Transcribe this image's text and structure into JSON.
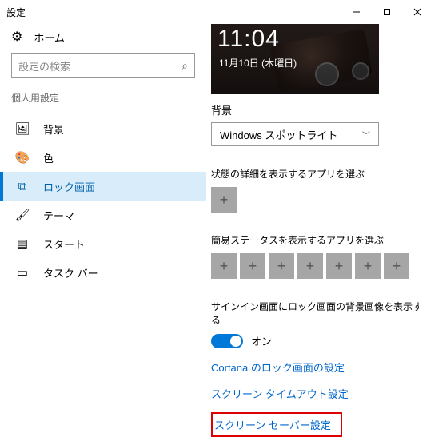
{
  "window": {
    "title": "設定"
  },
  "sidebar": {
    "home": "ホーム",
    "search_placeholder": "設定の検索",
    "section": "個人用設定",
    "items": [
      {
        "label": "背景"
      },
      {
        "label": "色"
      },
      {
        "label": "ロック画面"
      },
      {
        "label": "テーマ"
      },
      {
        "label": "スタート"
      },
      {
        "label": "タスク バー"
      }
    ]
  },
  "preview": {
    "time": "11:04",
    "date": "11月10日 (木曜日)"
  },
  "background": {
    "label": "背景",
    "value": "Windows スポットライト"
  },
  "detail_apps": {
    "label": "状態の詳細を表示するアプリを選ぶ"
  },
  "quick_apps": {
    "label": "簡易ステータスを表示するアプリを選ぶ"
  },
  "signin": {
    "label": "サインイン画面にロック画面の背景画像を表示する",
    "state": "オン"
  },
  "links": {
    "cortana": "Cortana のロック画面の設定",
    "timeout": "スクリーン タイムアウト設定",
    "saver": "スクリーン セーバー設定"
  }
}
